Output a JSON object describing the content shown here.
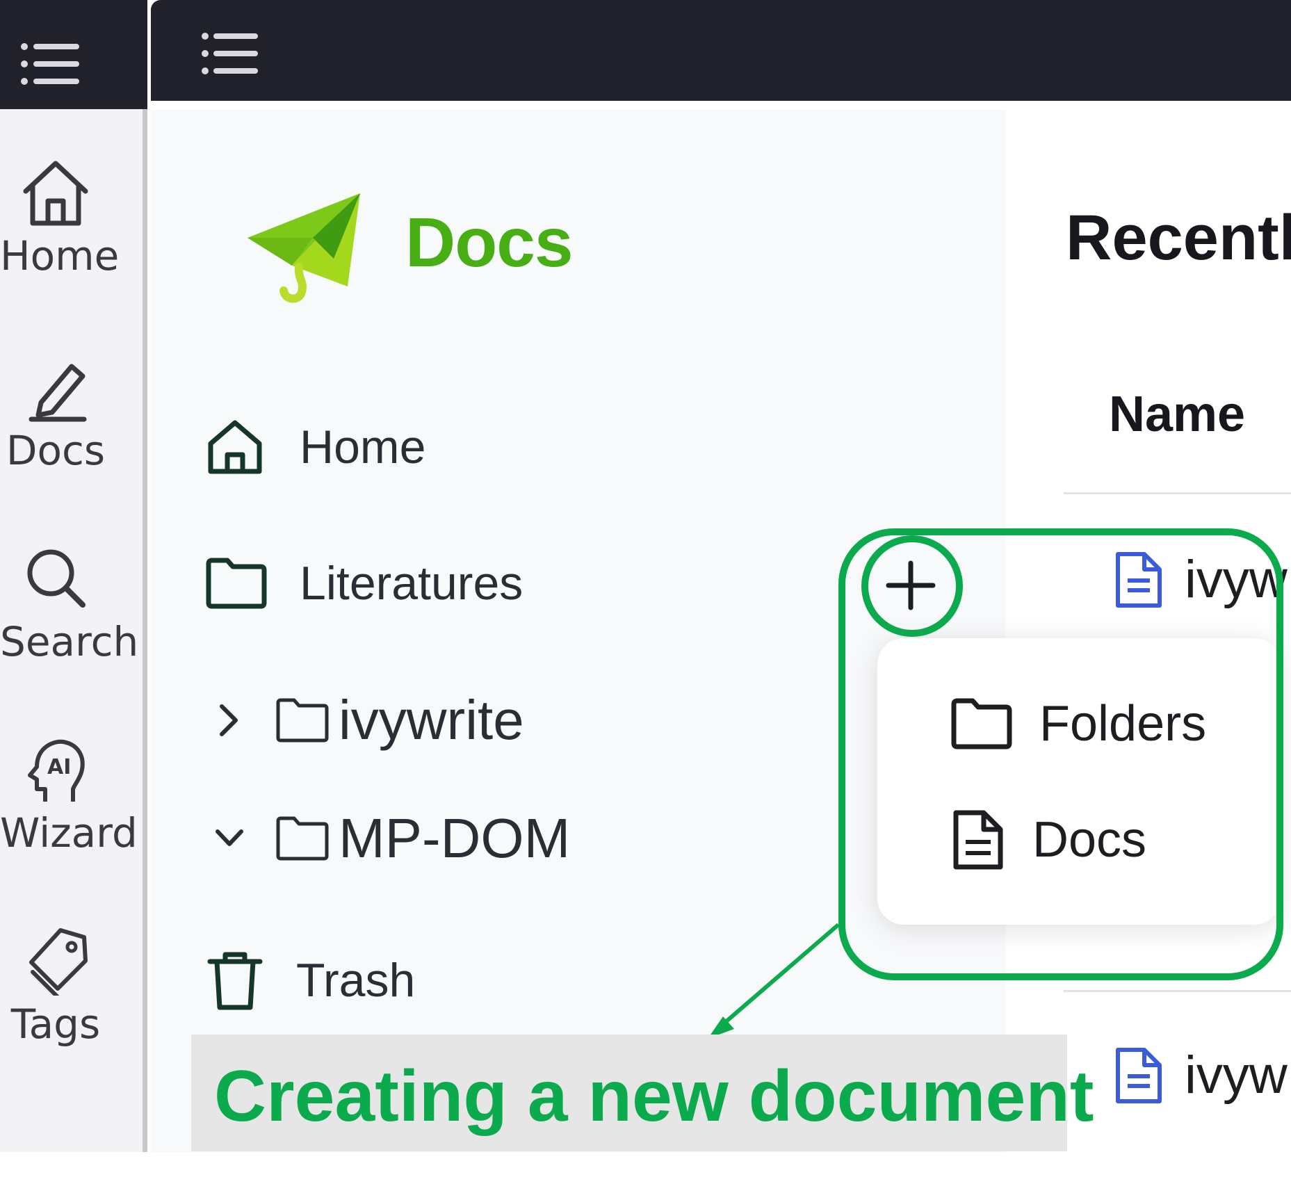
{
  "colors": {
    "accent_green": "#47ae14",
    "annotation_green": "#0bab4d",
    "topbar": "#20212b",
    "doc_blue": "#3b5bdb"
  },
  "rail": {
    "menu_icon": "hamburger-icon",
    "items": [
      {
        "label": "Home",
        "icon": "home-icon"
      },
      {
        "label": "Docs",
        "icon": "pen-icon"
      },
      {
        "label": "Search",
        "icon": "search-icon"
      },
      {
        "label": "Wizard",
        "icon": "ai-head-icon"
      },
      {
        "label": "Tags",
        "icon": "tag-icon"
      }
    ]
  },
  "topbar": {
    "menu_icon": "hamburger-icon"
  },
  "brand": {
    "name": "Docs",
    "logo_icon": "paper-plane-logo"
  },
  "sidebar": {
    "nav": [
      {
        "label": "Home",
        "icon": "home-icon"
      },
      {
        "label": "Literatures",
        "icon": "folder-icon"
      }
    ],
    "tree": [
      {
        "label": "ivywrite",
        "expanded": false
      },
      {
        "label": "MP-DOM",
        "expanded": true
      }
    ],
    "trash": {
      "label": "Trash",
      "icon": "trash-icon"
    }
  },
  "content": {
    "title": "Recentl",
    "column_name": "Name",
    "rows": [
      {
        "label": "ivyw"
      },
      {
        "label": "ivyw"
      }
    ]
  },
  "new_menu": {
    "button_icon": "plus-icon",
    "items": [
      {
        "label": "Folders",
        "icon": "folder-icon"
      },
      {
        "label": "Docs",
        "icon": "document-icon"
      }
    ]
  },
  "annotation": {
    "caption": "Creating a new document"
  }
}
